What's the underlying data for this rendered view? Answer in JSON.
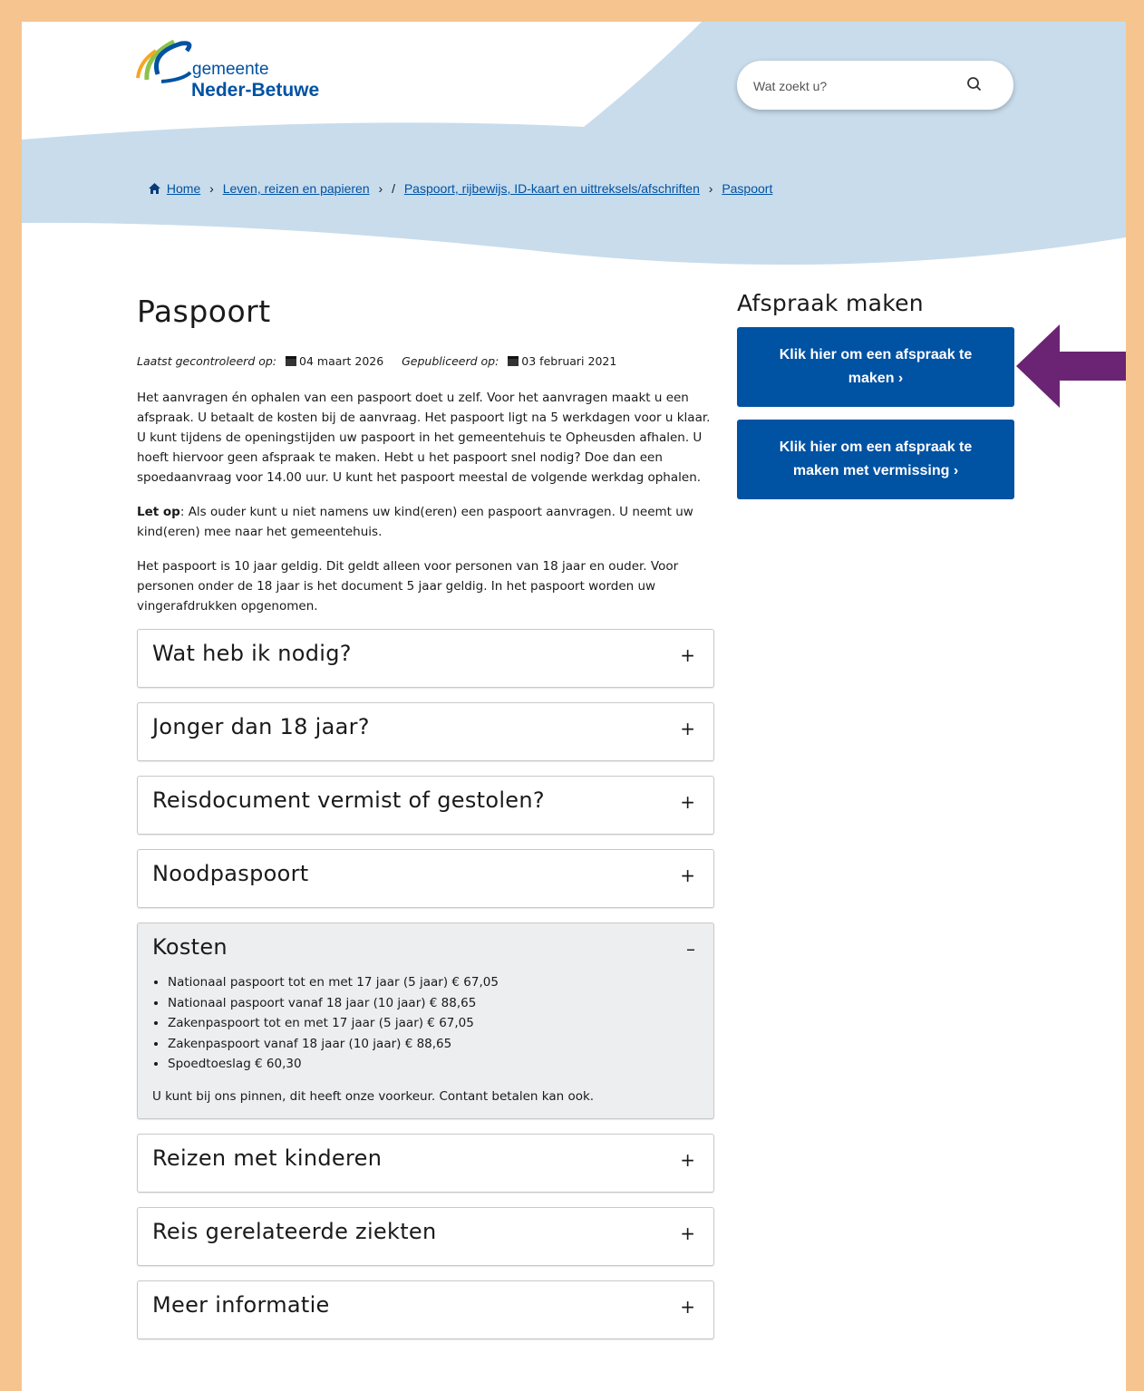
{
  "header": {
    "logo_line1": "gemeente",
    "logo_line2": "Neder-Betuwe",
    "search_placeholder": "Wat zoekt u?"
  },
  "breadcrumb": {
    "home": "Home",
    "item1": "Leven, reizen en papieren",
    "item2": "Paspoort, rijbewijs, ID-kaart en uittreksels/afschriften",
    "item3": "Paspoort",
    "sep_chevron": "›",
    "sep_slash": "/"
  },
  "page": {
    "title": "Paspoort",
    "checked_label": "Laatst gecontroleerd op:",
    "checked_date": "04 maart 2026",
    "published_label": "Gepubliceerd op:",
    "published_date": "03 februari 2021",
    "intro": "Het aanvragen én ophalen van een paspoort doet u zelf. Voor het aanvragen maakt u een afspraak. U betaalt de kosten bij de aanvraag. Het paspoort ligt na 5 werkdagen voor u klaar. U kunt tijdens de openingstijden uw paspoort in het gemeentehuis te Opheusden afhalen. U hoeft hiervoor geen afspraak te maken. Hebt u het paspoort snel nodig? Doe dan een spoedaanvraag voor 14.00 uur. U kunt het paspoort meestal de volgende werkdag ophalen.",
    "note_bold": "Let op",
    "note_text": ": Als ouder kunt u niet namens uw kind(eren) een paspoort aanvragen. U neemt uw kind(eren) mee naar het gemeentehuis.",
    "validity": "Het paspoort is 10 jaar geldig. Dit geldt alleen voor personen van 18 jaar en ouder. Voor personen onder de 18 jaar is het document 5 jaar geldig. In het paspoort worden uw vingerafdrukken opgenomen."
  },
  "accordion": {
    "plus": "+",
    "minus": "–",
    "items": [
      "Wat heb ik nodig?",
      "Jonger dan 18 jaar?",
      "Reisdocument vermist of gestolen?",
      "Noodpaspoort",
      "Kosten",
      "Reizen met kinderen",
      "Reis gerelateerde ziekten",
      "Meer informatie"
    ],
    "costs": [
      "Nationaal paspoort tot en met 17 jaar (5 jaar) € 67,05",
      "Nationaal paspoort vanaf 18 jaar (10 jaar) € 88,65",
      "Zakenpaspoort tot en met 17 jaar (5 jaar) € 67,05",
      "Zakenpaspoort vanaf 18 jaar (10 jaar) € 88,65",
      "Spoedtoeslag € 60,30"
    ],
    "costs_note": "U kunt bij ons pinnen, dit heeft onze voorkeur. Contant betalen kan ook."
  },
  "sidebar": {
    "title": "Afspraak maken",
    "button1": "Klik hier om een afspraak te maken  ›",
    "button2": "Klik hier om een afspraak te maken met vermissing  ›"
  },
  "colors": {
    "brand_blue": "#0052a3",
    "wave": "#c8dcec",
    "frame": "#f6c58f",
    "arrow": "#6b2473"
  }
}
